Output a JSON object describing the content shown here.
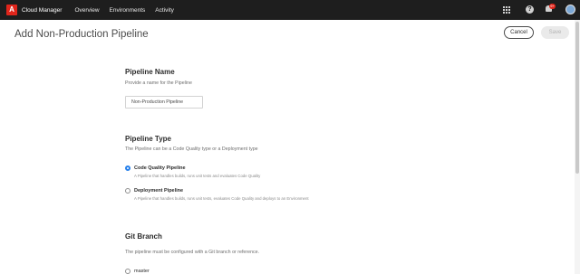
{
  "topbar": {
    "logo_mark": "A",
    "app_title": "Cloud Manager",
    "nav": [
      "Overview",
      "Environments",
      "Activity"
    ],
    "help_glyph": "?",
    "notification_count": "9+",
    "background": "#1e1e1e",
    "logo_color": "#e1251b"
  },
  "header": {
    "title": "Add Non-Production Pipeline",
    "cancel_label": "Cancel",
    "save_label": "Save"
  },
  "pipeline_name": {
    "heading": "Pipeline Name",
    "description": "Provide a name for the Pipeline",
    "value": "Non-Production Pipeline"
  },
  "pipeline_type": {
    "heading": "Pipeline Type",
    "description": "The Pipeline can be a Code Quality type or a Deployment type",
    "options": [
      {
        "label": "Code Quality Pipeline",
        "hint": "A Pipeline that handles builds, runs unit tests and evaluates Code Quality",
        "selected": true
      },
      {
        "label": "Deployment Pipeline",
        "hint": "A Pipeline that handles builds, runs unit tests, evaluates Code Quality and deploys to an Environment",
        "selected": false
      }
    ]
  },
  "git_branch": {
    "heading": "Git Branch",
    "description": "The pipeline must be configured with a Git branch or reference.",
    "first_option": "master"
  },
  "colors": {
    "accent": "#2680eb",
    "text": "#2c2c2c",
    "muted": "#6e6e6e"
  }
}
